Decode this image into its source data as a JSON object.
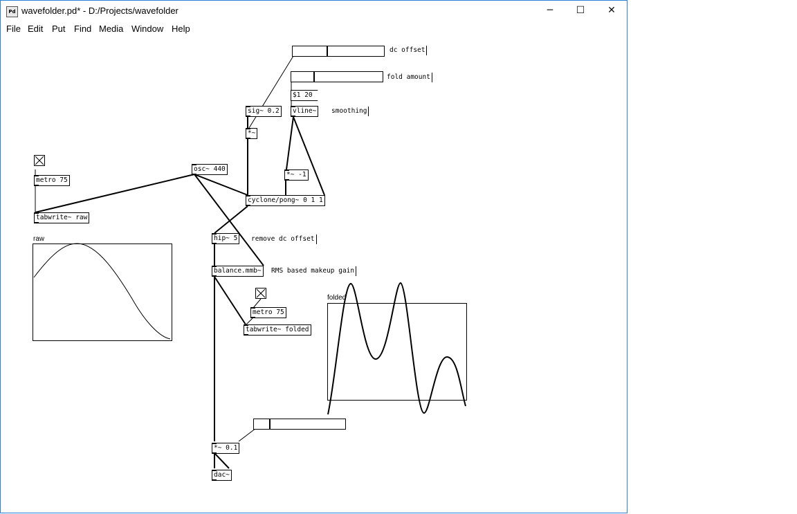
{
  "window": {
    "title": "wavefolder.pd* - D:/Projects/wavefolder",
    "app_icon_text": "Pd",
    "controls": {
      "minimize": "─",
      "maximize": "☐",
      "close": "✕"
    }
  },
  "menu": {
    "items": [
      "File",
      "Edit",
      "Put",
      "Find",
      "Media",
      "Window",
      "Help"
    ]
  },
  "patch": {
    "objects": {
      "sig": "sig~ 0.2",
      "mul_a": "*~",
      "vline": "vline~",
      "mul_neg": "*~ -1",
      "osc": "osc~ 440",
      "metro_top": "metro 75",
      "tabwrite_raw": "tabwrite~ raw",
      "pong": "cyclone/pong~ 0 1 1",
      "hip": "hip~ 5",
      "balance": "balance.mmb~",
      "metro_bottom": "metro 75",
      "tabwrite_folded": "tabwrite~ folded",
      "mul_gain": "*~ 0.1",
      "dac": "dac~"
    },
    "messages": {
      "fold_msg": "$1 20"
    },
    "comments": {
      "dc_offset": "dc offset",
      "fold_amount": "fold amount",
      "smoothing": "smoothing",
      "remove_dc": "remove dc offset",
      "makeup_gain": "RMS based makeup gain"
    },
    "sliders": {
      "dc_offset": 0.37,
      "fold_amount": 0.25,
      "volume": 0.17
    },
    "toggles": {
      "top": true,
      "bottom": true
    },
    "arrays": {
      "raw": {
        "label": "raw"
      },
      "folded": {
        "label": "folded"
      }
    }
  }
}
